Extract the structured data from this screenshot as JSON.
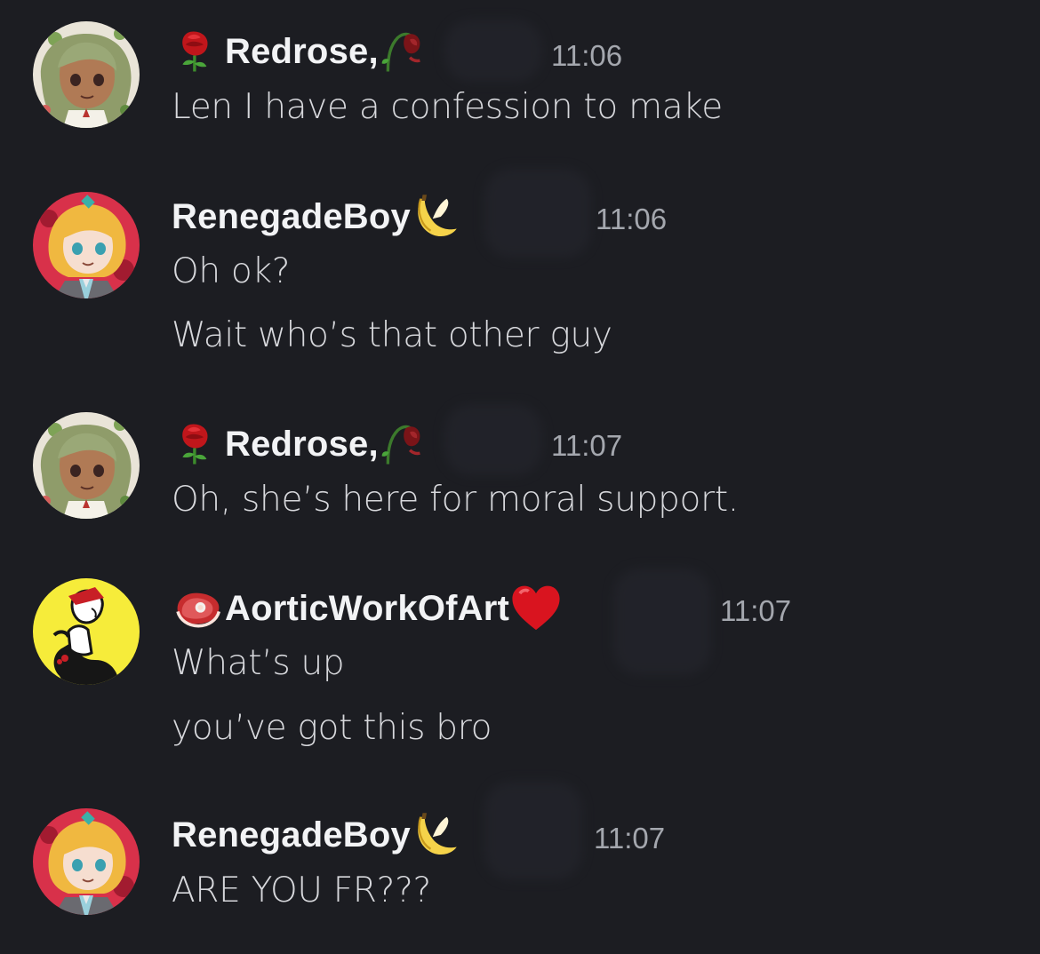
{
  "messages": [
    {
      "username": "Redrose",
      "timestamp": "11:06",
      "lines": [
        "Len I have a confession to make"
      ],
      "avatar": "avatar-redrose",
      "badges": [
        "rose-icon",
        "wilted-rose-icon"
      ]
    },
    {
      "username": "RenegadeBoy",
      "timestamp": "11:06",
      "lines": [
        "Oh ok?",
        "Wait who’s that other guy"
      ],
      "avatar": "avatar-renegadeboy",
      "badges": [
        "banana-icon"
      ]
    },
    {
      "username": "Redrose",
      "timestamp": "11:07",
      "lines": [
        "Oh, she’s here for moral support."
      ],
      "avatar": "avatar-redrose",
      "badges": [
        "rose-icon",
        "wilted-rose-icon"
      ]
    },
    {
      "username": "AorticWorkOfArt",
      "timestamp": "11:07",
      "lines": [
        "What’s up",
        "you’ve got this bro"
      ],
      "avatar": "avatar-aortic",
      "badges": [
        "meat-icon",
        "heart-icon"
      ]
    },
    {
      "username": "RenegadeBoy",
      "timestamp": "11:07",
      "lines": [
        "ARE YOU FR???"
      ],
      "avatar": "avatar-renegadeboy",
      "badges": [
        "banana-icon"
      ]
    }
  ],
  "colors": {
    "background": "#1c1d22",
    "username": "#f2f3f5",
    "timestamp": "#a4a7ae",
    "message": "#d7d8dc"
  }
}
